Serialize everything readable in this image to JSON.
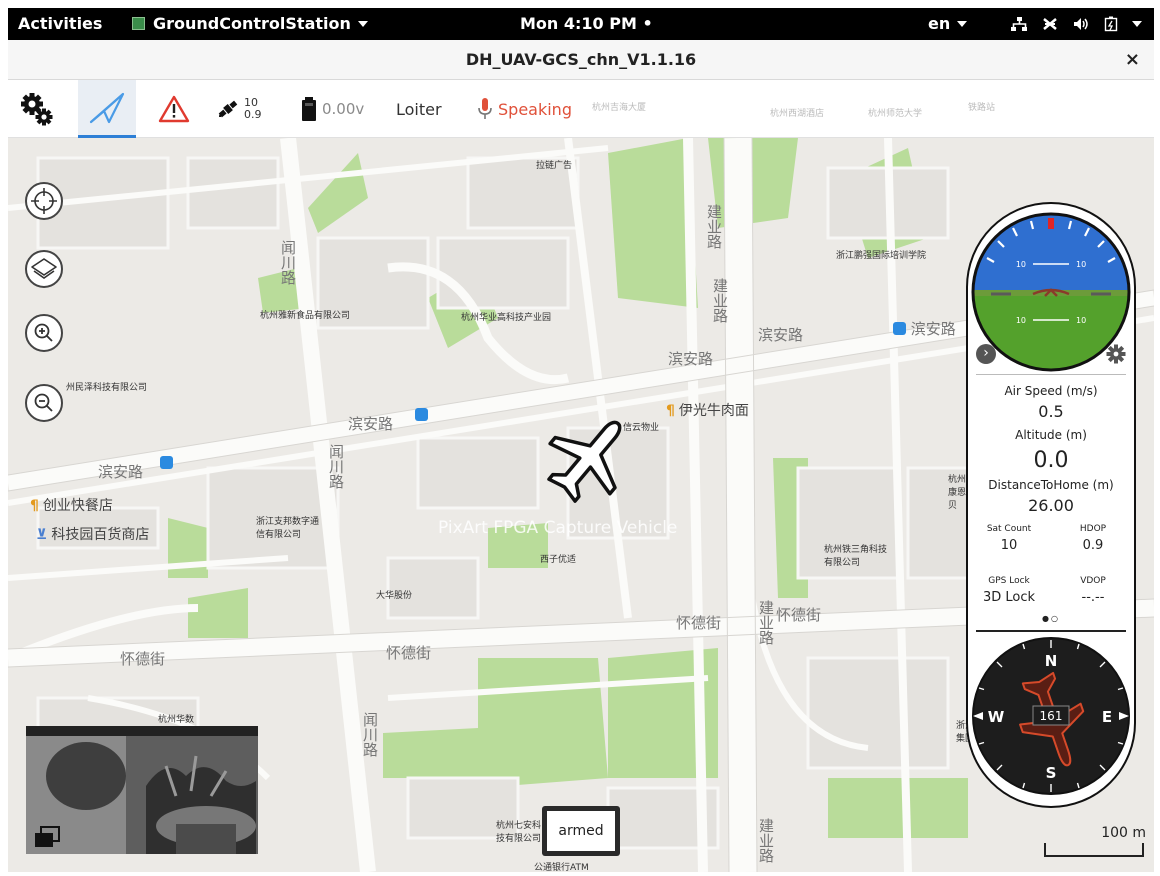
{
  "topbar": {
    "activities": "Activities",
    "app_name": "GroundControlStation",
    "clock": "Mon  4:10 PM",
    "clock_dot": "•",
    "lang": "en",
    "icons": [
      "network-icon",
      "airplane-mode-icon",
      "volume-icon",
      "battery-icon",
      "power-menu-icon"
    ]
  },
  "window": {
    "title": "DH_UAV-GCS_chn_V1.1.16",
    "close": "×"
  },
  "toolbar": {
    "gps_count": "10",
    "gps_hdop": "0.9",
    "battery_voltage": "0.00v",
    "flight_mode": "Loiter",
    "voice": "Speaking",
    "active_tool": "plan",
    "faint_labels": [
      "杭州吉海大厦",
      "杭州西湖酒店",
      "杭州师范大学",
      "铁路站"
    ]
  },
  "map": {
    "roads": [
      "滨安路",
      "滨安路",
      "滨安路",
      "滨安路",
      "滨安路",
      "建业路",
      "建业路",
      "建业路",
      "建业路",
      "闻川路",
      "闻川路",
      "闻川路",
      "怀德街",
      "怀德街",
      "怀德街",
      "怀德街"
    ],
    "places": [
      "拉链广告",
      "杭州雅新食品有限公司",
      "杭州华业高科技产业园",
      "州民泽科技有限公司",
      "浙江鹏强国际培训学院",
      "信云物业",
      "浙江支邦数字通信有限公司",
      "西子优适",
      "大华股份",
      "杭州铁三角科技有限公司",
      "杭州华数",
      "杭州七安科技有限公司",
      "杭州康恩贝",
      "浙江集团",
      "公通银行ATM"
    ],
    "pois": [
      {
        "icon": "restaurant-icon",
        "label": "伊光牛肉面"
      },
      {
        "icon": "restaurant-icon",
        "label": "创业快餐店"
      },
      {
        "icon": "shop-icon",
        "label": "科技园百货商店"
      },
      {
        "icon": "bus-stop-icon",
        "label": "滨安路"
      }
    ],
    "watermark": "PixArt FPGA Capture Vehicle",
    "armed_label": "armed",
    "scale_label": "100 m",
    "controls": [
      "locate-icon",
      "layers-icon",
      "zoom-in-icon",
      "zoom-out-icon"
    ]
  },
  "instruments": {
    "airspeed_label": "Air Speed (m/s)",
    "airspeed": "0.5",
    "altitude_label": "Altitude (m)",
    "altitude": "0.0",
    "distance_label": "DistanceToHome (m)",
    "distance": "26.00",
    "sat_label": "Sat Count",
    "sat": "10",
    "hdop_label": "HDOP",
    "hdop": "0.9",
    "gps_lock_label": "GPS Lock",
    "gps_lock": "3D Lock",
    "vdop_label": "VDOP",
    "vdop": "--.--",
    "pager": "●○",
    "pitch_marks": [
      "10",
      "10",
      "10",
      "10"
    ],
    "heading": "161",
    "compass": {
      "n": "N",
      "s": "S",
      "e": "E",
      "w": "W"
    },
    "colors": {
      "sky": "#2f6fd0",
      "ground": "#54a12c",
      "compass_bg": "#1d1d1d",
      "vehicle_outline": "#d64a2a"
    }
  }
}
